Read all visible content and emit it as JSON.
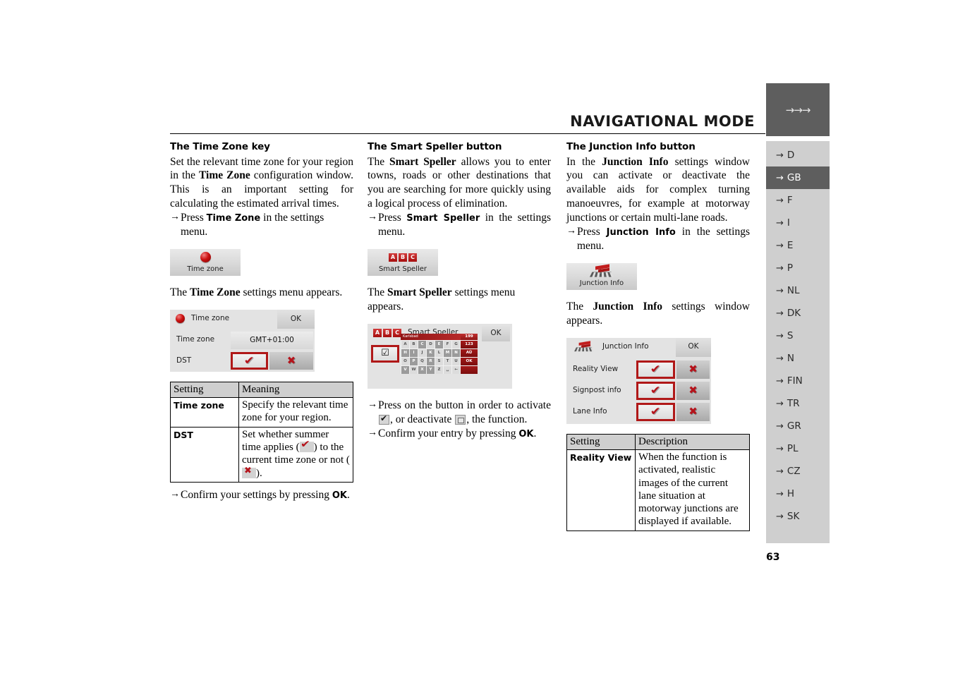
{
  "header": {
    "title": "NAVIGATIONAL MODE",
    "rail_arrows": "→→→"
  },
  "page_number": "63",
  "language_rail": {
    "items": [
      {
        "label": "D",
        "active": false
      },
      {
        "label": "GB",
        "active": true
      },
      {
        "label": "F",
        "active": false
      },
      {
        "label": "I",
        "active": false
      },
      {
        "label": "E",
        "active": false
      },
      {
        "label": "P",
        "active": false
      },
      {
        "label": "NL",
        "active": false
      },
      {
        "label": "DK",
        "active": false
      },
      {
        "label": "S",
        "active": false
      },
      {
        "label": "N",
        "active": false
      },
      {
        "label": "FIN",
        "active": false
      },
      {
        "label": "TR",
        "active": false
      },
      {
        "label": "GR",
        "active": false
      },
      {
        "label": "PL",
        "active": false
      },
      {
        "label": "CZ",
        "active": false
      },
      {
        "label": "H",
        "active": false
      },
      {
        "label": "SK",
        "active": false
      }
    ]
  },
  "column1": {
    "heading": "The Time Zone key",
    "intro": "Set the relevant time zone for your region in the ",
    "intro_b1": "Time Zone",
    "intro_2": " configuration window. This is an important setting for calculating the estimated arrival times.",
    "step1_pre": "Press ",
    "step1_b": "Time Zone",
    "step1_post": " in the settings menu.",
    "button": {
      "caption": "Time zone",
      "icon": "red-ball-icon"
    },
    "after_button_pre": "The ",
    "after_button_b": "Time Zone",
    "after_button_post": " settings menu appears.",
    "panel": {
      "title": "Time zone",
      "ok_label": "OK",
      "row1_label": "Time zone",
      "row1_value": "GMT+01:00",
      "row2_label": "DST",
      "tick_glyph": "✔",
      "cross_glyph": "✖"
    },
    "table": {
      "headers": [
        "Setting",
        "Meaning"
      ],
      "rows": [
        {
          "setting": "Time zone",
          "meaning": "Specify the relevant time zone for your region."
        },
        {
          "setting": "DST",
          "meaning_a": "Set whether summer time applies (",
          "meaning_b": ") to the current time zone or not (",
          "meaning_c": ")."
        }
      ]
    },
    "confirm_pre": "Confirm your settings by pressing ",
    "confirm_b": "OK",
    "confirm_post": "."
  },
  "column2": {
    "heading": "The Smart Speller button",
    "intro_pre": "The ",
    "intro_b": "Smart Speller",
    "intro_post": " allows you to enter towns, roads or other destinations that you are searching for more quickly using a logical process of elimination.",
    "step1_pre": "Press ",
    "step1_b": "Smart Speller",
    "step1_post": " in the settings menu.",
    "button": {
      "caption": "Smart Speller",
      "icon": "abc-icon",
      "letters": [
        "A",
        "B",
        "C"
      ]
    },
    "after_button_pre": "The ",
    "after_button_b": "Smart Speller",
    "after_button_post": " settings menu appears.",
    "panel": {
      "title": "Smart Speller",
      "ok_label": "OK",
      "checkbox_glyph": "☑",
      "keyboard": {
        "input_text": "Karlsbad",
        "counter": "199",
        "rows": [
          [
            "A",
            "B",
            "C",
            "D",
            "E",
            "F",
            "G"
          ],
          [
            "H",
            "I",
            "J",
            "K",
            "L",
            "M",
            "N"
          ],
          [
            "O",
            "P",
            "Q",
            "R",
            "S",
            "T",
            "U"
          ],
          [
            "V",
            "W",
            "X",
            "Y",
            "Z",
            "␣",
            "←"
          ]
        ],
        "active_keys": [
          "C",
          "E",
          "H",
          "I",
          "K",
          "M",
          "N",
          "P",
          "R",
          "V",
          "X",
          "Y"
        ],
        "side_keys": [
          "123",
          "AÜ",
          "OK"
        ]
      }
    },
    "step2_pre": "Press on the button in order to activate ",
    "step2_mid": ", or deactivate ",
    "step2_post": ", the function.",
    "step3_pre": "Confirm your entry by pressing ",
    "step3_b": "OK",
    "step3_post": "."
  },
  "column3": {
    "heading": "The Junction Info button",
    "intro_pre": "In the ",
    "intro_b": "Junction Info",
    "intro_post": " settings window you can activate or deactivate the available aids for complex turning manoeuvres, for example at motorway junctions or certain multi-lane roads.",
    "step1_pre": "Press ",
    "step1_b": "Junction Info",
    "step1_post": " in the settings menu.",
    "button": {
      "caption": "Junction Info",
      "icon": "junction-signpost-icon"
    },
    "after_button_pre": "The ",
    "after_button_b": "Junction Info",
    "after_button_post": " settings window appears.",
    "panel": {
      "title": "Junction Info",
      "ok_label": "OK",
      "rows": [
        {
          "label": "Reality View",
          "tick_selected": true
        },
        {
          "label": "Signpost info",
          "tick_selected": true
        },
        {
          "label": "Lane Info",
          "tick_selected": true
        }
      ],
      "tick_glyph": "✔",
      "cross_glyph": "✖"
    },
    "table": {
      "headers": [
        "Setting",
        "Description"
      ],
      "rows": [
        {
          "setting": "Reality View",
          "description": "When the function is activated, realistic images of the current lane situation at motorway junctions are displayed if available."
        }
      ]
    }
  },
  "colors": {
    "accent_red": "#b5131b",
    "rail_active": "#5e5e5e",
    "rail_bg": "#cfcfcf",
    "panel_bg": "#e3e3e3"
  }
}
